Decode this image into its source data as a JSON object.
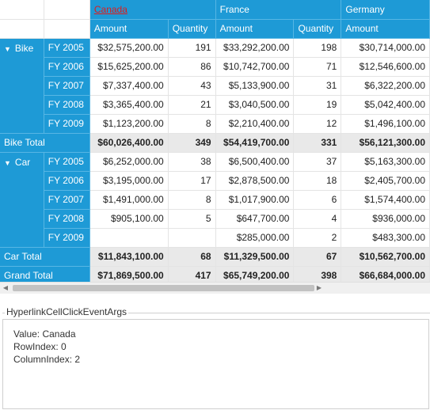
{
  "columns": {
    "countries": [
      "Canada",
      "France",
      "Germany"
    ],
    "measures": [
      "Amount",
      "Quantity"
    ]
  },
  "groups": [
    {
      "name": "Bike",
      "rows": [
        {
          "year": "FY 2005",
          "canada_amount": "$32,575,200.00",
          "canada_qty": "191",
          "france_amount": "$33,292,200.00",
          "france_qty": "198",
          "germany_amount": "$30,714,000.00"
        },
        {
          "year": "FY 2006",
          "canada_amount": "$15,625,200.00",
          "canada_qty": "86",
          "france_amount": "$10,742,700.00",
          "france_qty": "71",
          "germany_amount": "$12,546,600.00"
        },
        {
          "year": "FY 2007",
          "canada_amount": "$7,337,400.00",
          "canada_qty": "43",
          "france_amount": "$5,133,900.00",
          "france_qty": "31",
          "germany_amount": "$6,322,200.00"
        },
        {
          "year": "FY 2008",
          "canada_amount": "$3,365,400.00",
          "canada_qty": "21",
          "france_amount": "$3,040,500.00",
          "france_qty": "19",
          "germany_amount": "$5,042,400.00"
        },
        {
          "year": "FY 2009",
          "canada_amount": "$1,123,200.00",
          "canada_qty": "8",
          "france_amount": "$2,210,400.00",
          "france_qty": "12",
          "germany_amount": "$1,496,100.00"
        }
      ],
      "total": {
        "label": "Bike Total",
        "canada_amount": "$60,026,400.00",
        "canada_qty": "349",
        "france_amount": "$54,419,700.00",
        "france_qty": "331",
        "germany_amount": "$56,121,300.00"
      }
    },
    {
      "name": "Car",
      "rows": [
        {
          "year": "FY 2005",
          "canada_amount": "$6,252,000.00",
          "canada_qty": "38",
          "france_amount": "$6,500,400.00",
          "france_qty": "37",
          "germany_amount": "$5,163,300.00"
        },
        {
          "year": "FY 2006",
          "canada_amount": "$3,195,000.00",
          "canada_qty": "17",
          "france_amount": "$2,878,500.00",
          "france_qty": "18",
          "germany_amount": "$2,405,700.00"
        },
        {
          "year": "FY 2007",
          "canada_amount": "$1,491,000.00",
          "canada_qty": "8",
          "france_amount": "$1,017,900.00",
          "france_qty": "6",
          "germany_amount": "$1,574,400.00"
        },
        {
          "year": "FY 2008",
          "canada_amount": "$905,100.00",
          "canada_qty": "5",
          "france_amount": "$647,700.00",
          "france_qty": "4",
          "germany_amount": "$936,000.00"
        },
        {
          "year": "FY 2009",
          "canada_amount": "",
          "canada_qty": "",
          "france_amount": "$285,000.00",
          "france_qty": "2",
          "germany_amount": "$483,300.00"
        }
      ],
      "total": {
        "label": "Car Total",
        "canada_amount": "$11,843,100.00",
        "canada_qty": "68",
        "france_amount": "$11,329,500.00",
        "france_qty": "67",
        "germany_amount": "$10,562,700.00"
      }
    }
  ],
  "grand_total": {
    "label": "Grand Total",
    "canada_amount": "$71,869,500.00",
    "canada_qty": "417",
    "france_amount": "$65,749,200.00",
    "france_qty": "398",
    "germany_amount": "$66,684,000.00"
  },
  "event_panel": {
    "title": "HyperlinkCellClickEventArgs",
    "value_line": "Value: Canada",
    "row_line": "RowIndex: 0",
    "col_line": "ColumnIndex: 2"
  },
  "icons": {
    "expand": "triangle-down-icon",
    "scroll_left": "chevron-left-icon",
    "scroll_right": "chevron-right-icon"
  },
  "colors": {
    "header_bg": "#1e9ad6",
    "total_bg": "#e9e9e9",
    "link": "#e01b1b"
  }
}
